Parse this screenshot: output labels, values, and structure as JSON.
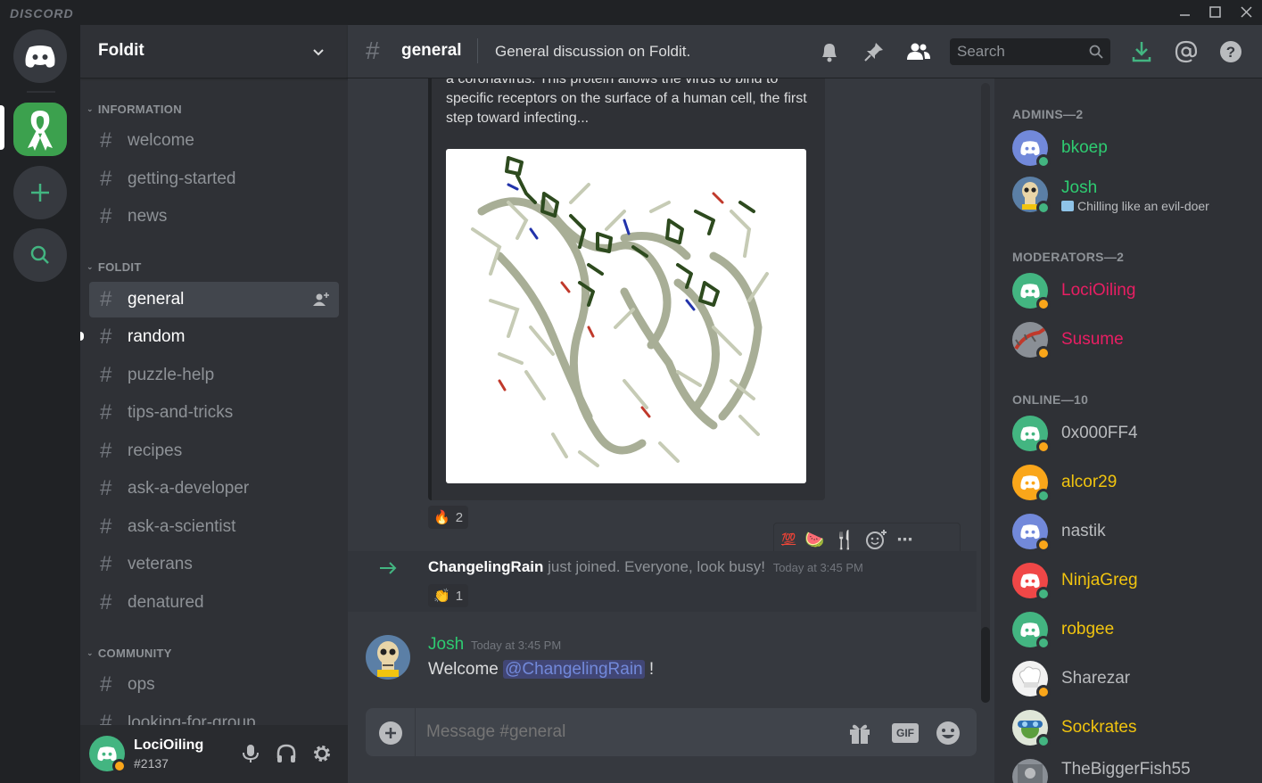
{
  "app": {
    "brand": "DISCORD"
  },
  "server": {
    "name": "Foldit"
  },
  "categories": {
    "information": "INFORMATION",
    "foldit": "FOLDIT",
    "community": "COMMUNITY"
  },
  "channels": {
    "welcome": "welcome",
    "getting_started": "getting-started",
    "news": "news",
    "general": "general",
    "random": "random",
    "puzzle_help": "puzzle-help",
    "tips": "tips-and-tricks",
    "recipes": "recipes",
    "ask_dev": "ask-a-developer",
    "ask_sci": "ask-a-scientist",
    "veterans": "veterans",
    "denatured": "denatured",
    "ops": "ops",
    "lfg": "looking-for-group"
  },
  "current_user": {
    "name": "LociOiling",
    "tag": "#2137"
  },
  "topbar": {
    "channel": "general",
    "topic": "General discussion on Foldit.",
    "search_placeholder": "Search"
  },
  "messages": {
    "embed_text": "a coronavirus. This protein allows the virus to bind to specific receptors on the surface of a human cell, the first step toward infecting...",
    "reaction_fire_count": "2",
    "join": {
      "user": "ChangelingRain",
      "text": "just joined. Everyone, look busy!",
      "time": "Today at 3:45 PM",
      "reaction_count": "1"
    },
    "josh": {
      "user": "Josh",
      "time": "Today at 3:45 PM",
      "text": "Welcome",
      "mention": "@ChangelingRain",
      "tail": "!"
    }
  },
  "composer": {
    "placeholder": "Message #general"
  },
  "members": {
    "admins_header": "ADMINS—2",
    "moderators_header": "MODERATORS—2",
    "online_header": "ONLINE—10",
    "admins": [
      {
        "name": "bkoep",
        "color": "#2ecc71"
      },
      {
        "name": "Josh",
        "color": "#2ecc71",
        "status": "Chilling like an evil-doer"
      }
    ],
    "moderators": [
      {
        "name": "LociOiling",
        "color": "#e91e63"
      },
      {
        "name": "Susume",
        "color": "#e91e63"
      }
    ],
    "online": [
      {
        "name": "0x000FF4",
        "color": "#b9bbbe"
      },
      {
        "name": "alcor29",
        "color": "#f1c40f"
      },
      {
        "name": "nastik",
        "color": "#b9bbbe"
      },
      {
        "name": "NinjaGreg",
        "color": "#f1c40f"
      },
      {
        "name": "robgee",
        "color": "#f1c40f"
      },
      {
        "name": "Sharezar",
        "color": "#b9bbbe"
      },
      {
        "name": "Sockrates",
        "color": "#f1c40f"
      },
      {
        "name": "TheBiggerFish55",
        "color": "#b9bbbe"
      }
    ]
  },
  "colors": {
    "accent": "#7289da",
    "online": "#43b581",
    "idle": "#faa61a",
    "mention_bg": "#414675",
    "mention_fg": "#7289da"
  }
}
